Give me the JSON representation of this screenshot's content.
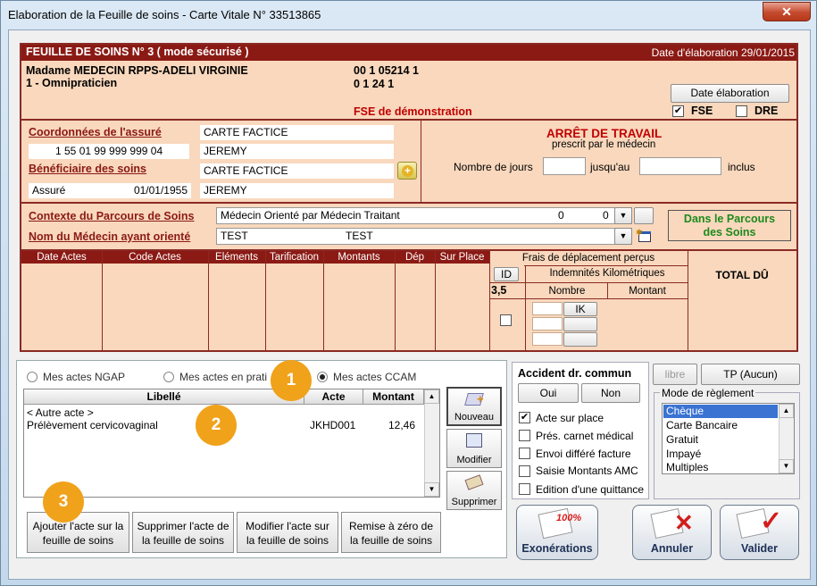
{
  "window": {
    "title": "Elaboration de la Feuille de soins - Carte Vitale N° 33513865",
    "close": "✕"
  },
  "fse": {
    "header_title": "FEUILLE DE SOINS  N° 3 ( mode sécurisé )",
    "date_elaboration_text": "Date d'élaboration 29/01/2015",
    "doctor_name": "Madame MEDECIN RPPS-ADELI VIRGINIE",
    "doctor_specialty": "1 - Omnipraticien",
    "code1": "00 1 05214 1",
    "code2": "0 1 24 1",
    "demo_label": "FSE de démonstration",
    "date_button": "Date élaboration",
    "fse_check": {
      "label": "FSE",
      "checked": true
    },
    "dre_check": {
      "label": "DRE",
      "checked": false
    }
  },
  "assure": {
    "coord_label": "Coordonnées de l'assuré",
    "name": "CARTE FACTICE",
    "number": "1 55 01 99 999 999 04",
    "firstname": "JEREMY",
    "beneficiaire_label": "Bénéficiaire des soins",
    "benef_name": "CARTE FACTICE",
    "benef_type": "Assuré",
    "benef_birth": "01/01/1955",
    "benef_firstname": "JEREMY"
  },
  "arret": {
    "title": "ARRÊT DE TRAVAIL",
    "subtitle": "prescrit par le médecin",
    "nb_jours_label": "Nombre de jours",
    "jusquau_label": "jusqu'au",
    "inclus_label": "inclus",
    "nb_jours": "",
    "jusquau": ""
  },
  "parcours": {
    "contexte_label": "Contexte du Parcours de Soins",
    "contexte_value": "Médecin Orienté par Médecin Traitant",
    "contexte_n1": "0",
    "contexte_n2": "0",
    "medecin_label": "Nom du Médecin ayant orienté",
    "medecin_v1": "TEST",
    "medecin_v2": "TEST",
    "status_line1": "Dans le Parcours",
    "status_line2": "des Soins"
  },
  "actes_table": {
    "headers": [
      "Date Actes",
      "Code Actes",
      "Eléments",
      "Tarification",
      "Montants",
      "Dép",
      "Sur Place"
    ],
    "frais_title": "Frais de déplacement perçus",
    "id_label": "ID",
    "indemnites_label": "Indemnités Kilométriques",
    "id_value": "3,5",
    "nombre_label": "Nombre",
    "montant_label": "Montant",
    "ik_label": "IK",
    "total_label": "TOTAL DÛ"
  },
  "tabs": {
    "ngap": "Mes actes NGAP",
    "pratique": "Mes actes en prati",
    "ccam": "Mes actes CCAM",
    "selected": "ccam"
  },
  "acts_list": {
    "headers": {
      "libelle": "Libellé",
      "acte": "Acte",
      "montant": "Montant"
    },
    "rows": [
      {
        "libelle": "< Autre acte >",
        "acte": "",
        "montant": ""
      },
      {
        "libelle": "Prélèvement cervicovaginal",
        "acte": "JKHD001",
        "montant": "12,46"
      }
    ]
  },
  "tools": {
    "nouveau": "Nouveau",
    "modifier": "Modifier",
    "supprimer": "Supprimer"
  },
  "act_buttons": [
    {
      "l1": "Ajouter l'acte sur la",
      "l2": "feuille de soins"
    },
    {
      "l1": "Supprimer l'acte de",
      "l2": "la feuille de soins"
    },
    {
      "l1": "Modifier l'acte sur",
      "l2": "la feuille de soins"
    },
    {
      "l1": "Remise à zéro de",
      "l2": "la feuille de soins"
    }
  ],
  "badges": [
    "1",
    "2",
    "3"
  ],
  "accident": {
    "title": "Accident dr. commun",
    "oui": "Oui",
    "non": "Non"
  },
  "options": [
    {
      "label": "Acte sur place",
      "checked": true
    },
    {
      "label": "Prés. carnet médical",
      "checked": false
    },
    {
      "label": "Envoi différé facture",
      "checked": false
    },
    {
      "label": "Saisie Montants AMC",
      "checked": false
    },
    {
      "label": "Edition d'une quittance",
      "checked": false
    }
  ],
  "tp": {
    "libre": "libre",
    "tp": "TP (Aucun)"
  },
  "reglement": {
    "title": "Mode de règlement",
    "options": [
      "Chèque",
      "Carte Bancaire",
      "Gratuit",
      "Impayé",
      "Multiples"
    ],
    "selected": "Chèque"
  },
  "footer": {
    "exonerations": "Exonérations",
    "exo_badge": "100%",
    "annuler": "Annuler",
    "valider": "Valider"
  }
}
